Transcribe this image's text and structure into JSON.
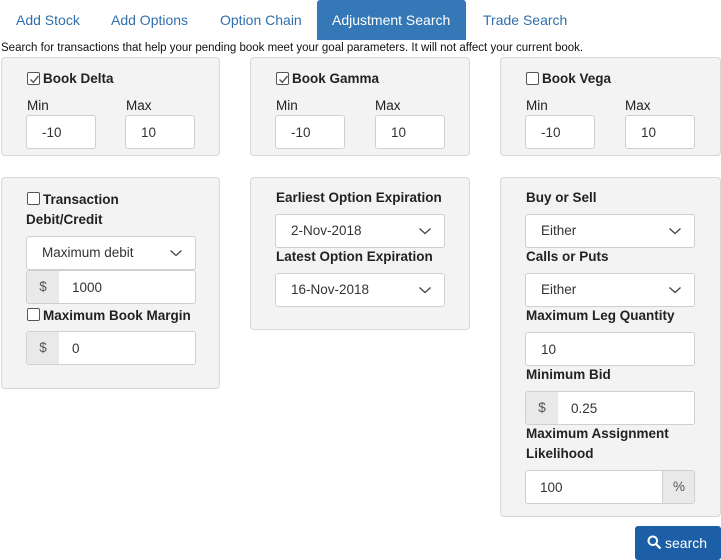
{
  "tabs": {
    "add_stock": "Add Stock",
    "add_options": "Add Options",
    "option_chain": "Option Chain",
    "adjustment_search": "Adjustment Search",
    "trade_search": "Trade Search"
  },
  "description": "Search for transactions that help your pending book meet your goal parameters. It will not affect your current book.",
  "delta": {
    "label": "Book Delta",
    "checked": true,
    "min_label": "Min",
    "max_label": "Max",
    "min": "-10",
    "max": "10"
  },
  "gamma": {
    "label": "Book Gamma",
    "checked": true,
    "min_label": "Min",
    "max_label": "Max",
    "min": "-10",
    "max": "10"
  },
  "vega": {
    "label": "Book Vega",
    "checked": false,
    "min_label": "Min",
    "max_label": "Max",
    "min": "-10",
    "max": "10"
  },
  "transaction": {
    "label_line1": "Transaction",
    "label_line2": "Debit/Credit",
    "checked": false,
    "mode": "Maximum debit",
    "currency": "$",
    "amount": "1000",
    "margin_label": "Maximum Book Margin",
    "margin_checked": false,
    "margin_currency": "$",
    "margin_value": "0"
  },
  "expiration": {
    "earliest_label": "Earliest Option Expiration",
    "earliest": "2-Nov-2018",
    "latest_label": "Latest Option Expiration",
    "latest": "16-Nov-2018"
  },
  "filters": {
    "buy_sell_label": "Buy or Sell",
    "buy_sell": "Either",
    "calls_puts_label": "Calls or Puts",
    "calls_puts": "Either",
    "max_leg_qty_label": "Maximum Leg Quantity",
    "max_leg_qty": "10",
    "min_bid_label": "Minimum Bid",
    "min_bid_currency": "$",
    "min_bid": "0.25",
    "max_assign_label_line1": "Maximum Assignment",
    "max_assign_label_line2": "Likelihood",
    "max_assign": "100",
    "percent": "%"
  },
  "search_button": {
    "icon": "search-icon",
    "label": "search"
  },
  "colors": {
    "accent": "#3478b7",
    "button": "#1c5fa6",
    "link": "#2f6fad",
    "panel": "#f3f3f3"
  }
}
